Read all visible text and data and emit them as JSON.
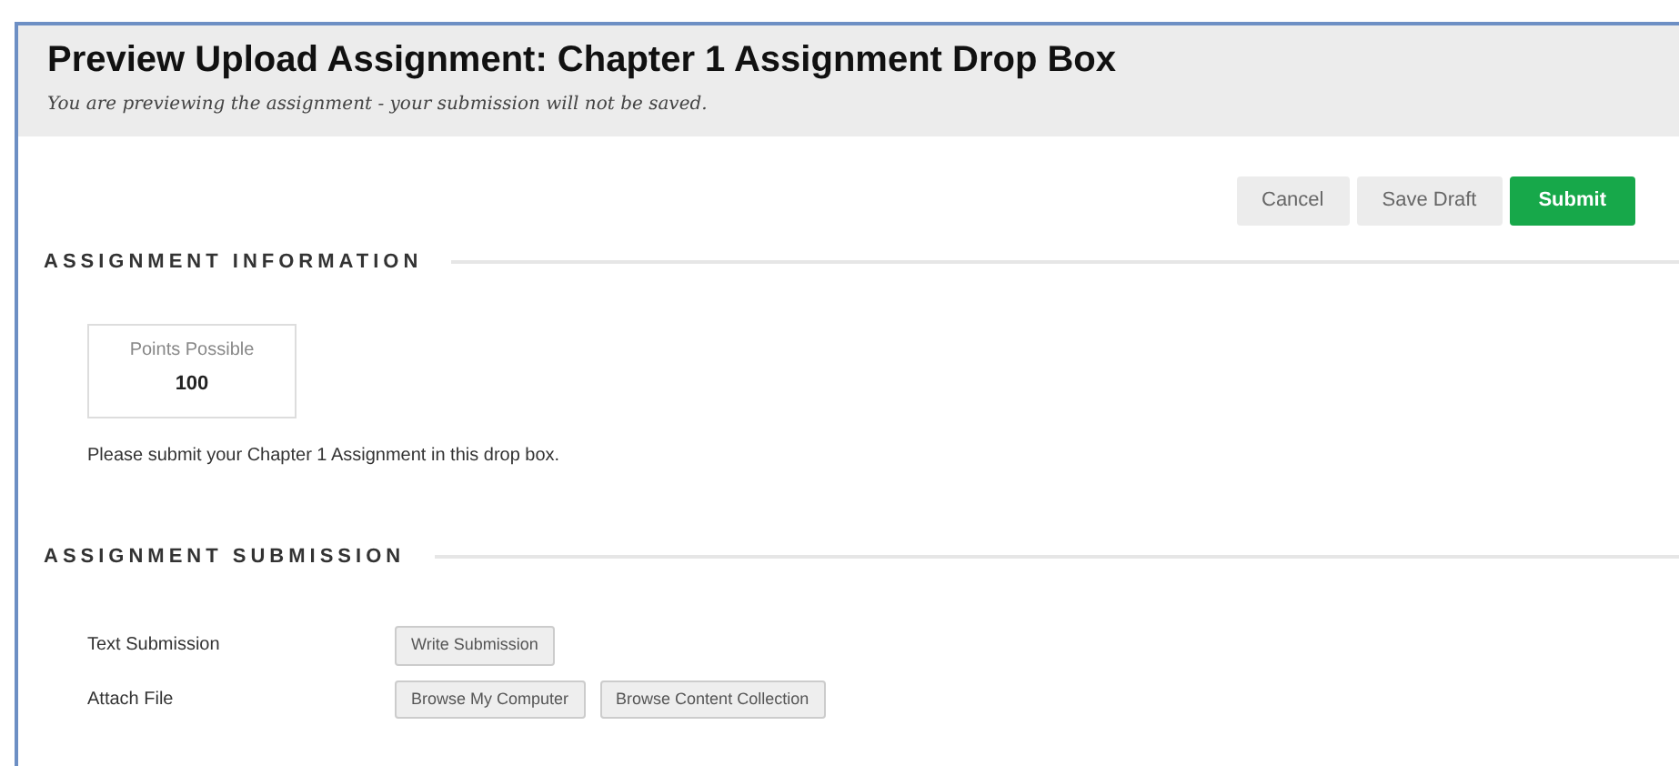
{
  "header": {
    "title": "Preview Upload Assignment: Chapter 1 Assignment Drop Box",
    "subtitle": "You are previewing the assignment - your submission will not be saved."
  },
  "actions": [
    {
      "label": "Cancel",
      "kind": "default"
    },
    {
      "label": "Save Draft",
      "kind": "default"
    },
    {
      "label": "Submit",
      "kind": "primary"
    }
  ],
  "information": {
    "heading": "ASSIGNMENT INFORMATION",
    "points_label": "Points Possible",
    "points_value": "100",
    "instructions": "Please submit your Chapter 1 Assignment in this drop box."
  },
  "submission": {
    "heading": "ASSIGNMENT SUBMISSION",
    "rows": [
      {
        "label": "Text Submission",
        "buttons": [
          "Write Submission"
        ]
      },
      {
        "label": "Attach File",
        "buttons": [
          "Browse My Computer",
          "Browse Content Collection"
        ]
      }
    ]
  }
}
